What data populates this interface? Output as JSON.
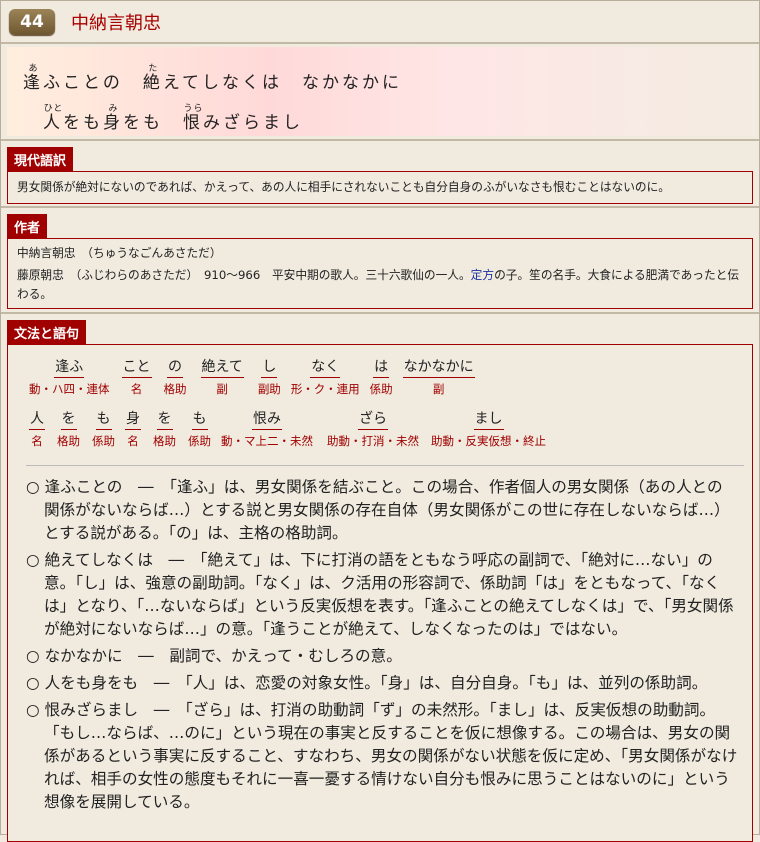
{
  "header": {
    "number": "44",
    "title": "中納言朝忠"
  },
  "poem": {
    "line1": [
      {
        "rb": "逢",
        "rt": "あ"
      },
      {
        "t": "ふことの　"
      },
      {
        "rb": "絶",
        "rt": "た"
      },
      {
        "t": "えてしなくは　なかなかに"
      }
    ],
    "line2": [
      {
        "rb": "人",
        "rt": "ひと"
      },
      {
        "t": "をも"
      },
      {
        "rb": "身",
        "rt": "み"
      },
      {
        "t": "をも　"
      },
      {
        "rb": "恨",
        "rt": "うら"
      },
      {
        "t": "みざらまし"
      }
    ]
  },
  "translation": {
    "label": "現代語訳",
    "text": "男女関係が絶対にないのであれば、かえって、あの人に相手にされないことも自分自身のふがいなさも恨むことはないのに。"
  },
  "author": {
    "label": "作者",
    "line1": "中納言朝忠　（ちゅうなごんあさただ）",
    "line2_pre": "藤原朝忠　（ふじわらのあさただ）　910～966　平安中期の歌人。三十六歌仙の一人。",
    "link": "定方",
    "line2_post": "の子。笙の名手。大食による肥満であったと伝わる。"
  },
  "grammar": {
    "label": "文法と語句",
    "row1": [
      {
        "w": "逢ふ",
        "p": "動・ハ四・連体"
      },
      {
        "w": "こと",
        "p": "名"
      },
      {
        "w": "の",
        "p": "格助"
      },
      {
        "w": "絶えて",
        "p": "副"
      },
      {
        "w": "し",
        "p": "副助"
      },
      {
        "w": "なく",
        "p": "形・ク・連用"
      },
      {
        "w": "は",
        "p": "係助"
      },
      {
        "w": "なかなかに",
        "p": "副"
      }
    ],
    "row2": [
      {
        "w": "人",
        "p": "名"
      },
      {
        "w": "を",
        "p": "格助"
      },
      {
        "w": "も",
        "p": "係助"
      },
      {
        "w": "身",
        "p": "名"
      },
      {
        "w": "を",
        "p": "格助"
      },
      {
        "w": "も",
        "p": "係助"
      },
      {
        "w": "恨み",
        "p": "動・マ上二・未然"
      },
      {
        "w": "ざら",
        "p": "助動・打消・未然"
      },
      {
        "w": "まし",
        "p": "助動・反実仮想・終止"
      }
    ],
    "notes": [
      "○ 逢ふことの　―　「逢ふ」は、男女関係を結ぶこと。この場合、作者個人の男女関係（あの人との関係がないならば…）とする説と男女関係の存在自体（男女関係がこの世に存在しないならば…）とする説がある。「の」は、主格の格助詞。",
      "○ 絶えてしなくは　―　「絶えて」は、下に打消の語をともなう呼応の副詞で、「絶対に…ない」の意。「し」は、強意の副助詞。「なく」は、ク活用の形容詞で、係助詞「は」をともなって、「なくは」となり、「…ないならば」という反実仮想を表す。「逢ふことの絶えてしなくは」で、「男女関係が絶対にないならば…」の意。「逢うことが絶えて、しなくなったのは」ではない。",
      "○ なかなかに　―　副詞で、かえって・むしろの意。",
      "○ 人をも身をも　―　「人」は、恋愛の対象女性。「身」は、自分自身。「も」は、並列の係助詞。",
      "○ 恨みざらまし　―　「ざら」は、打消の助動詞「ず」の未然形。「まし」は、反実仮想の助動詞。「もし…ならば、…のに」という現在の事実と反することを仮に想像する。この場合は、男女の関係があるという事実に反すること、すなわち、男女の関係がない状態を仮に定め、「男女関係がなければ、相手の女性の態度もそれに一喜一憂する情けない自分も恨みに思うことはないのに」という想像を展開している。"
    ]
  }
}
